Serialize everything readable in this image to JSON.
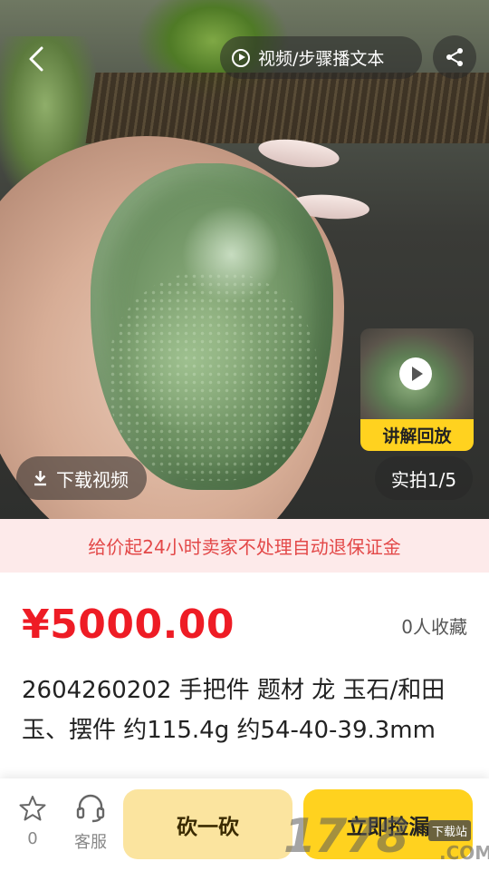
{
  "media": {
    "video_tab_label": "视频/步骤播文本",
    "replay_label": "讲解回放",
    "download_label": "下载视频",
    "photo_counter": "实拍1/5"
  },
  "notice": {
    "text": "给价起24小时卖家不处理自动退保证金"
  },
  "product": {
    "price": "¥5000.00",
    "favorites": "0人收藏",
    "title": "2604260202 手把件 题材 龙 玉石/和田玉、摆件 约115.4g 约54-40-39.3mm"
  },
  "bottom_bar": {
    "favorite_count": "0",
    "service_label": "客服",
    "bargain_label": "砍一砍",
    "buy_label": "立即捡漏"
  },
  "watermark": {
    "text": "1778",
    "badge": "下载站",
    "suffix": ".COM"
  },
  "colors": {
    "price": "#ee1c25",
    "accent_yellow": "#ffd21f",
    "notice_text": "#e34848",
    "notice_bg": "#fdeaea"
  },
  "icons": [
    "back-arrow-icon",
    "play-circle-icon",
    "share-icon",
    "download-icon",
    "star-icon",
    "headset-icon"
  ]
}
